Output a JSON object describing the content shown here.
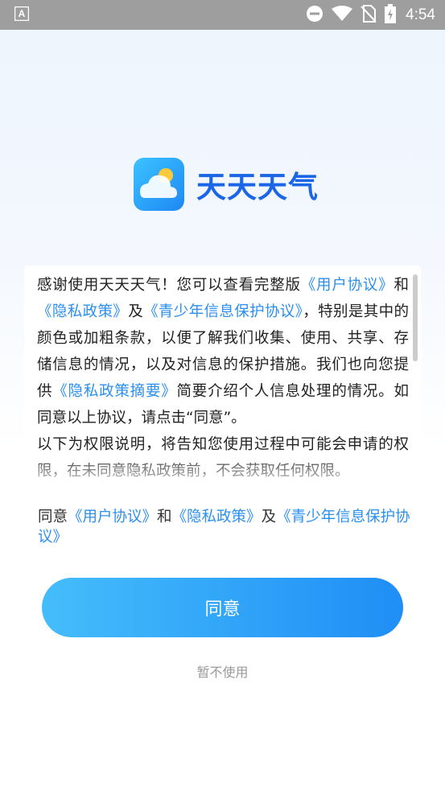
{
  "status_bar": {
    "time": "4:54",
    "icons": [
      "a-icon",
      "minus-circle-icon",
      "wifi-icon",
      "no-sim-icon",
      "battery-charging-icon"
    ]
  },
  "app": {
    "name": "天天天气",
    "icon": "weather-cloud-sun-icon"
  },
  "policy": {
    "segments": [
      {
        "t": "感谢使用天天天气！您可以查看完整版",
        "link": false
      },
      {
        "t": "《用户协议》",
        "link": true
      },
      {
        "t": "和",
        "link": false
      },
      {
        "t": "《隐私政策》",
        "link": true
      },
      {
        "t": "及",
        "link": false
      },
      {
        "t": "《青少年信息保护协议》",
        "link": true
      },
      {
        "t": "，特别是其中的颜色或加粗条款，以便了解我们收集、使用、共享、存储信息的情况，以及对信息的保护措施。我们也向您提供",
        "link": false
      },
      {
        "t": "《隐私政策摘要》",
        "link": true
      },
      {
        "t": "简要介绍个人信息处理的情况。如同意以上协议，请点击“同意”。",
        "link": false
      },
      {
        "t": "\n以下为权限说明，将告知您使用过程中可能会申请的权限，在未同意隐私政策前，不会获取任何权限。",
        "link": false
      }
    ]
  },
  "agree_line": {
    "prefix": "同意",
    "user_agreement": "《用户协议》",
    "and": "和",
    "privacy_policy": "《隐私政策》",
    "with": "及",
    "youth_agreement": "《青少年信息保护协议》"
  },
  "buttons": {
    "agree": "同意",
    "decline": "暂不使用"
  },
  "colors": {
    "link": "#2b8ff0",
    "brand": "#1a66e6",
    "button_start": "#45bdfb",
    "button_end": "#1f8ef6"
  }
}
